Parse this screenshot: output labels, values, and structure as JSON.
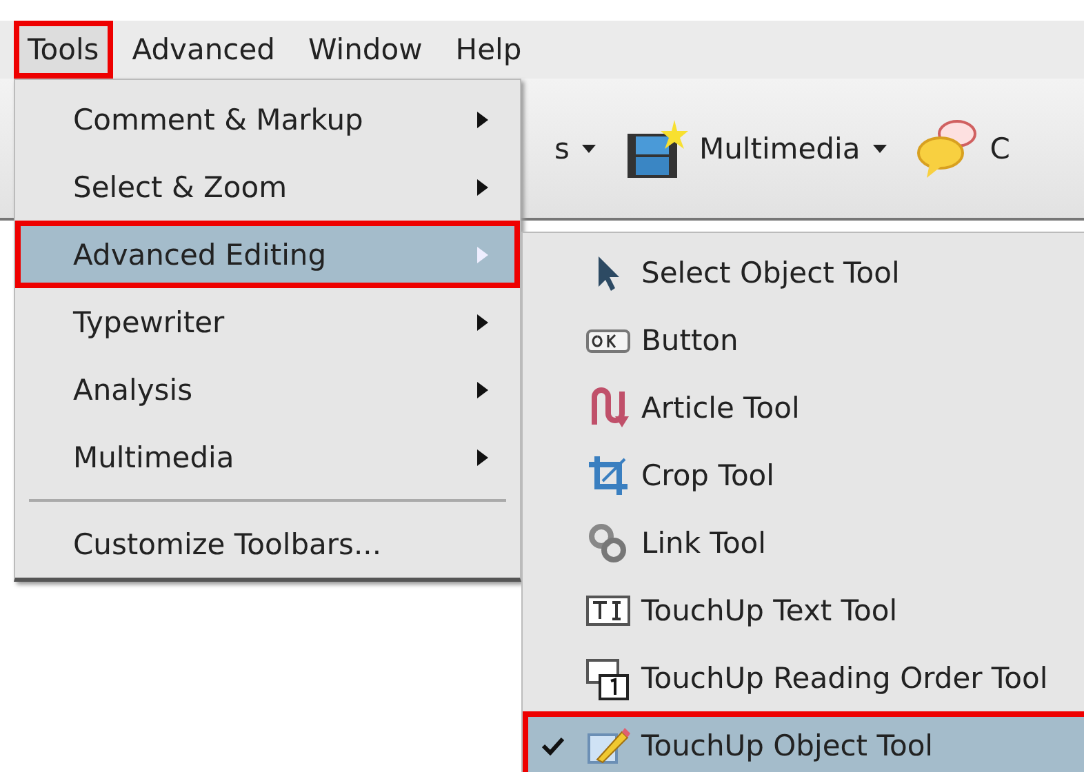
{
  "menu_bar": [
    {
      "label": "Tools",
      "selected": true,
      "highlighted": true
    },
    {
      "label": "Advanced",
      "selected": false,
      "highlighted": false
    },
    {
      "label": "Window",
      "selected": false,
      "highlighted": false
    },
    {
      "label": "Help",
      "selected": false,
      "highlighted": false
    }
  ],
  "toolbar": [
    {
      "label": "s",
      "dropdown": true
    },
    {
      "label": "Multimedia",
      "dropdown": true
    },
    {
      "label": "C",
      "dropdown": false
    }
  ],
  "tools_menu": [
    {
      "kind": "item",
      "label": "Comment & Markup",
      "submenu": true,
      "selected": false,
      "highlighted": false
    },
    {
      "kind": "item",
      "label": "Select & Zoom",
      "submenu": true,
      "selected": false,
      "highlighted": false
    },
    {
      "kind": "item",
      "label": "Advanced Editing",
      "submenu": true,
      "selected": true,
      "highlighted": true
    },
    {
      "kind": "item",
      "label": "Typewriter",
      "submenu": true,
      "selected": false,
      "highlighted": false
    },
    {
      "kind": "item",
      "label": "Analysis",
      "submenu": true,
      "selected": false,
      "highlighted": false
    },
    {
      "kind": "item",
      "label": "Multimedia",
      "submenu": true,
      "selected": false,
      "highlighted": false
    },
    {
      "kind": "separator"
    },
    {
      "kind": "item",
      "label": "Customize Toolbars...",
      "submenu": false,
      "selected": false,
      "highlighted": false
    }
  ],
  "advanced_editing_submenu": [
    {
      "label": "Select Object Tool",
      "checked": false,
      "selected": false,
      "highlighted": false
    },
    {
      "label": "Button",
      "checked": false,
      "selected": false,
      "highlighted": false
    },
    {
      "label": "Article Tool",
      "checked": false,
      "selected": false,
      "highlighted": false
    },
    {
      "label": "Crop Tool",
      "checked": false,
      "selected": false,
      "highlighted": false
    },
    {
      "label": "Link Tool",
      "checked": false,
      "selected": false,
      "highlighted": false
    },
    {
      "label": "TouchUp Text Tool",
      "checked": false,
      "selected": false,
      "highlighted": false
    },
    {
      "label": "TouchUp Reading Order Tool",
      "checked": false,
      "selected": false,
      "highlighted": false
    },
    {
      "label": "TouchUp Object Tool",
      "checked": true,
      "selected": true,
      "highlighted": true
    }
  ]
}
